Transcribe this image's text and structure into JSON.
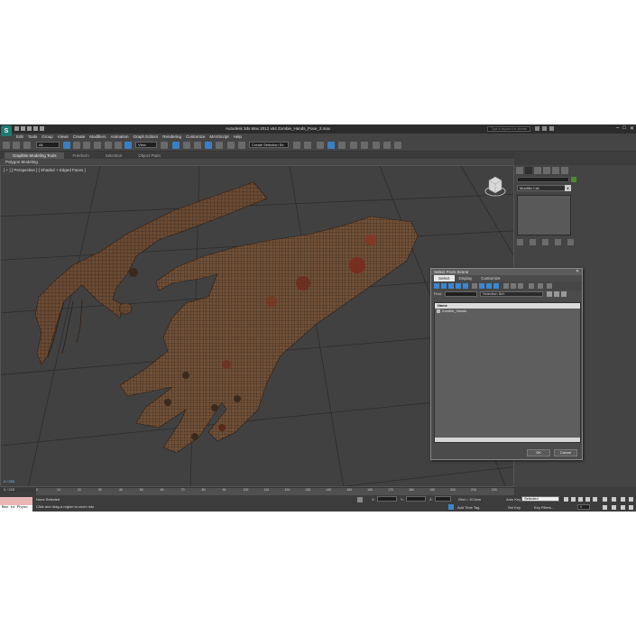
{
  "window": {
    "app_logo": "S",
    "title": "Autodesk 3ds Max  2012 x64      Zombie_Hands_Pose_2.max",
    "search_placeholder": "Type a keyword or phrase",
    "buttons": [
      "–",
      "□",
      "✕"
    ]
  },
  "menu": [
    "Edit",
    "Tools",
    "Group",
    "Views",
    "Create",
    "Modifiers",
    "Animation",
    "Graph Editors",
    "Rendering",
    "Customize",
    "MAXScript",
    "Help"
  ],
  "toolbar": {
    "selection_filter": "All",
    "ref_coord": "View",
    "named_selection": "Create Selection Se"
  },
  "ribbon": {
    "tabs": [
      "Graphite Modeling Tools",
      "Freeform",
      "Selection",
      "Object Paint"
    ],
    "active_tab": 0,
    "panel_label": "Polygon Modeling"
  },
  "viewport": {
    "label": "[ + ] [ Perspective ] [ Shaded + Edged Faces ]",
    "coords": "0 / 220"
  },
  "command_panel": {
    "modifier_list": "Modifier List",
    "object_color": "#4d8c2b"
  },
  "dialog": {
    "title": "Select From Scene",
    "close": "✕",
    "menu": [
      "Select",
      "Display",
      "Customize"
    ],
    "find_label": "Find:",
    "selection_set": "Selection Set:",
    "list_header": "Name",
    "items": [
      "Zombie_Hands"
    ],
    "ok": "OK",
    "cancel": "Cancel"
  },
  "timeline": {
    "position": "0 / 220",
    "ticks": [
      "0",
      "10",
      "20",
      "30",
      "40",
      "50",
      "60",
      "70",
      "80",
      "90",
      "100",
      "110",
      "120",
      "130",
      "140",
      "150",
      "160",
      "170",
      "180",
      "190",
      "200",
      "210",
      "220"
    ]
  },
  "status": {
    "maxscript_text": "Max to Physc",
    "selected": "None Selected",
    "prompt": "Click and drag-a region to zoom into",
    "x_label": "X:",
    "y_label": "Y:",
    "z_label": "Z:",
    "grid": "Grid = 10.0cm",
    "add_time_tag": "Add Time Tag",
    "auto_key": "Auto Key",
    "selected_dropdown": "Selected",
    "set_key": "Set Key",
    "key_filters": "Key Filters...",
    "frame": "0"
  }
}
